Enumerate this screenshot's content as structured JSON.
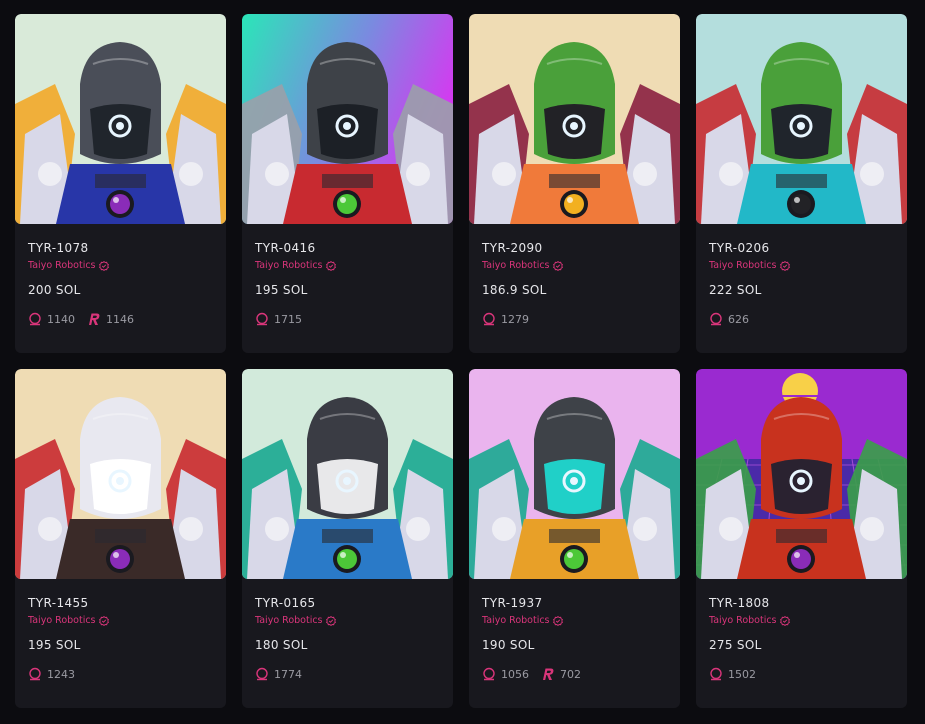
{
  "colors": {
    "background": "#0c0c10",
    "card": "#18181e",
    "accent_pink": "#d9357a"
  },
  "cards": [
    {
      "name": "TYR-1078",
      "collection": "Taiyo Robotics",
      "price": "200 SOL",
      "stat_a": "1140",
      "stat_b": "1146",
      "bg": "#d9ead9",
      "helmet": "#4a4e58",
      "visor": "#20252c",
      "body": "#2836a8",
      "accent": "#f2a828",
      "gem": "#8a2cb8"
    },
    {
      "name": "TYR-0416",
      "collection": "Taiyo Robotics",
      "price": "195 SOL",
      "stat_a": "1715",
      "stat_b": "",
      "bg": "#49c6b8",
      "helmet": "#3e4248",
      "visor": "#1c2026",
      "body": "#c82a30",
      "accent": "#9aa0aa",
      "gem": "#4cc838"
    },
    {
      "name": "TYR-2090",
      "collection": "Taiyo Robotics",
      "price": "186.9 SOL",
      "stat_a": "1279",
      "stat_b": "",
      "bg": "#efdcb4",
      "helmet": "#4aa03a",
      "visor": "#222226",
      "body": "#f07a3a",
      "accent": "#8a2040",
      "gem": "#f2b020"
    },
    {
      "name": "TYR-0206",
      "collection": "Taiyo Robotics",
      "price": "222 SOL",
      "stat_a": "626",
      "stat_b": "",
      "bg": "#b4dedd",
      "helmet": "#4aa03a",
      "visor": "#20252c",
      "body": "#22b8c8",
      "accent": "#c82a30",
      "gem": "#222226"
    },
    {
      "name": "TYR-1455",
      "collection": "Taiyo Robotics",
      "price": "195 SOL",
      "stat_a": "1243",
      "stat_b": "",
      "bg": "#efdcb4",
      "helmet": "#e8e8f0",
      "visor": "#ffffff",
      "body": "#3a2a28",
      "accent": "#c82a30",
      "gem": "#8a2cb8"
    },
    {
      "name": "TYR-0165",
      "collection": "Taiyo Robotics",
      "price": "180 SOL",
      "stat_a": "1774",
      "stat_b": "",
      "bg": "#d2eadb",
      "helmet": "#3a3c44",
      "visor": "#e8e8ea",
      "body": "#2a7ac8",
      "accent": "#1aa890",
      "gem": "#4cc838"
    },
    {
      "name": "TYR-1937",
      "collection": "Taiyo Robotics",
      "price": "190 SOL",
      "stat_a": "1056",
      "stat_b": "702",
      "bg": "#eab4ee",
      "helmet": "#3e4248",
      "visor": "#20d0c8",
      "body": "#e8a028",
      "accent": "#1aa890",
      "gem": "#4cc838"
    },
    {
      "name": "TYR-1808",
      "collection": "Taiyo Robotics",
      "price": "275 SOL",
      "stat_a": "1502",
      "stat_b": "",
      "bg": "#9a2ad0",
      "helmet": "#c8321e",
      "visor": "#2a2230",
      "body": "#c8321e",
      "accent": "#3aa048",
      "gem": "#8a2cb8"
    }
  ]
}
